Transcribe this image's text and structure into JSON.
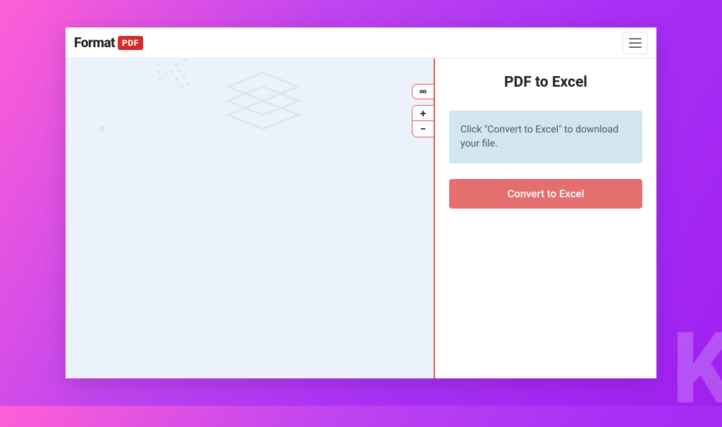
{
  "logo": {
    "word": "Format",
    "badge": "PDF"
  },
  "panel": {
    "title": "PDF to Excel",
    "info": "Click \"Convert to Excel\" to download your file.",
    "convert_label": "Convert to Excel"
  },
  "tools": {
    "settings_icon": "settings",
    "zoom_in": "+",
    "zoom_out": "−"
  },
  "watermark": "K"
}
